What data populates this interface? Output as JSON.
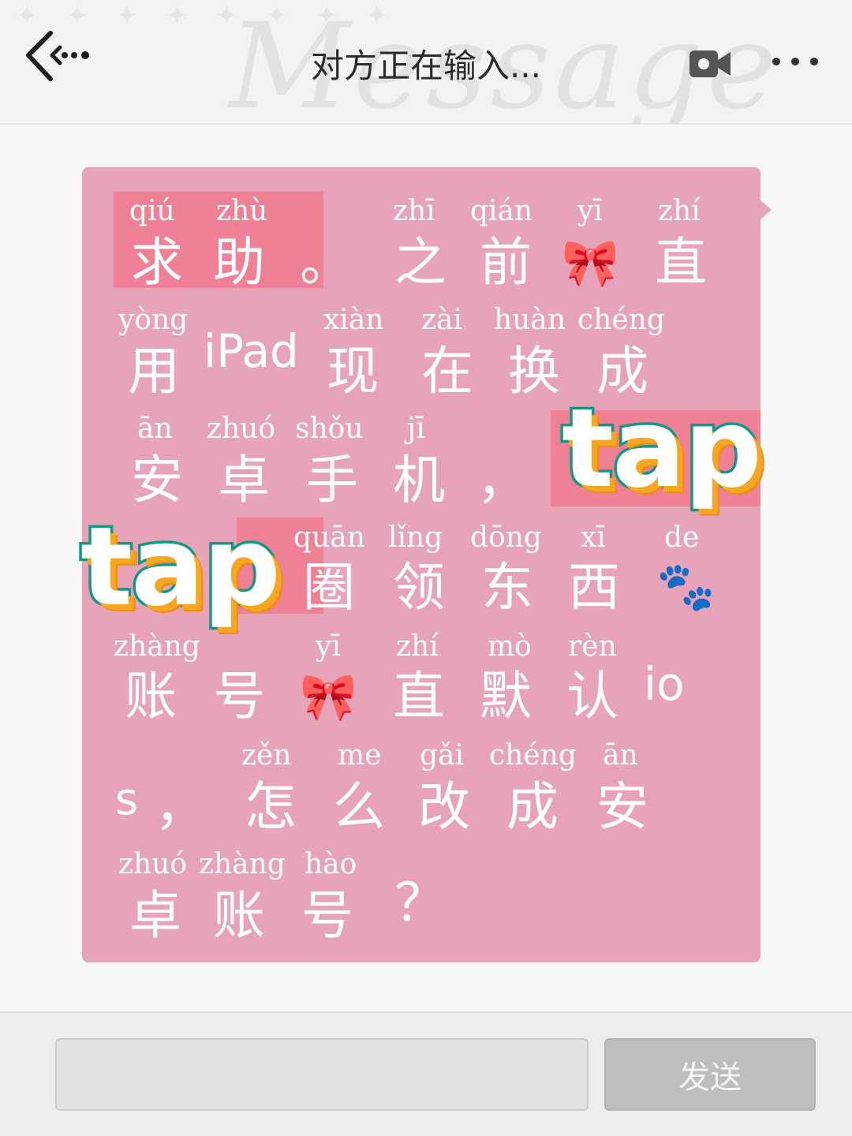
{
  "header": {
    "title": "对方正在输入...",
    "watermark": "Message",
    "back_icon": "back-arrow-icon",
    "video_icon": "video-camera-icon",
    "more_icon": "more-dots-icon"
  },
  "message": {
    "lines": [
      {
        "pinyin": [
          "qiú",
          "zhù",
          "zhī",
          "qián",
          "yī",
          "zhí"
        ],
        "hanzi": [
          "求",
          "助",
          "。",
          "之",
          "前",
          "🎀",
          "直"
        ]
      },
      {
        "pinyin": [
          "yòng",
          "xiàn",
          "zài",
          "huàn",
          "chéng"
        ],
        "hanzi": [
          "用",
          "iPad",
          "现",
          "在",
          "换",
          "成"
        ]
      },
      {
        "pinyin": [
          "ān",
          "zhuó",
          "shǒu",
          "jī"
        ],
        "hanzi": [
          "安",
          "卓",
          "手",
          "机",
          "，"
        ]
      },
      {
        "pinyin": [
          "quān",
          "lǐng",
          "dōng",
          "xī",
          "de"
        ],
        "hanzi": [
          "圈",
          "领",
          "东",
          "西",
          "🐾"
        ]
      },
      {
        "pinyin": [
          "zhàng",
          "yī",
          "zhí",
          "mò",
          "rèn"
        ],
        "hanzi": [
          "账",
          "号",
          "🎀",
          "直",
          "默",
          "认",
          "io"
        ]
      },
      {
        "pinyin": [
          "zěn",
          "me",
          "gǎi",
          "chéng",
          "ān"
        ],
        "hanzi": [
          "s",
          "，",
          "怎",
          "么",
          "改",
          "成",
          "安"
        ]
      },
      {
        "pinyin": [
          "zhuó",
          "zhàng",
          "hào"
        ],
        "hanzi": [
          "卓",
          "账",
          "号",
          "？"
        ]
      }
    ],
    "sticker_text": "tap"
  },
  "composer": {
    "input_value": "",
    "send_label": "发送"
  },
  "colors": {
    "bubble": "#e7a4b8",
    "highlight": "#ef8096",
    "sticker_outline": "#109a86",
    "sticker_shadow": "#f6a722"
  }
}
